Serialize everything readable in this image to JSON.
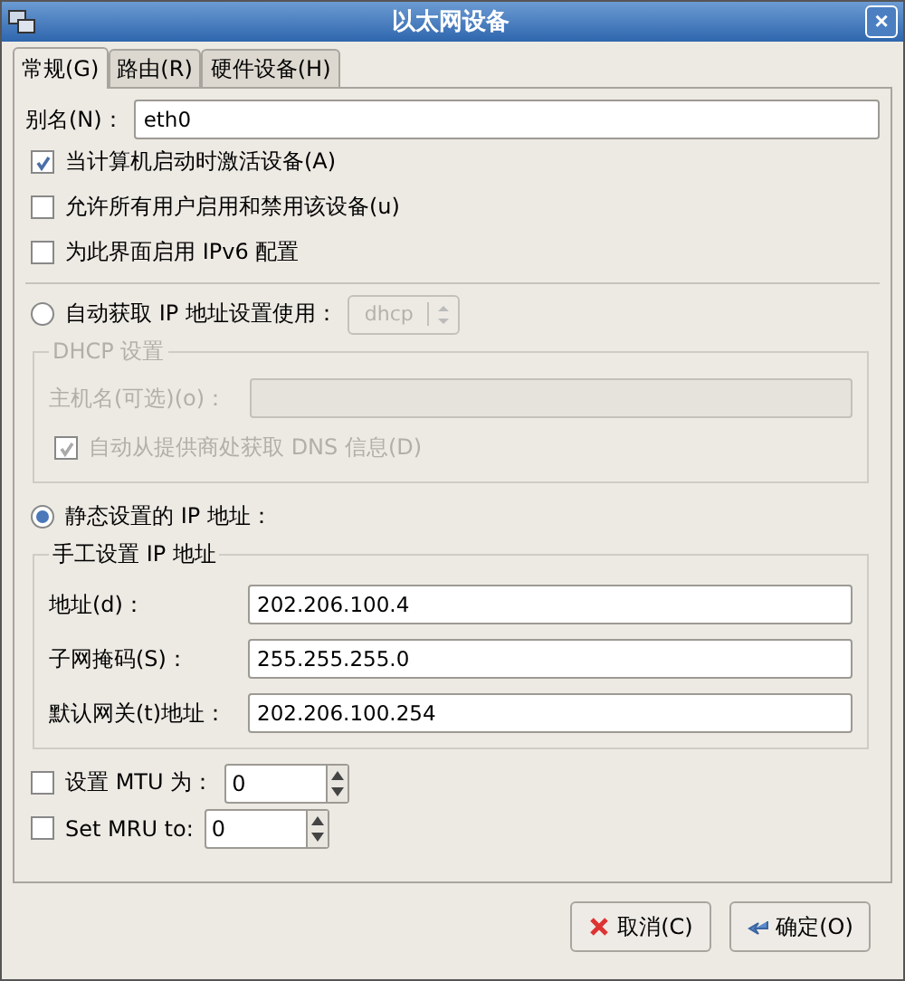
{
  "window": {
    "title": "以太网设备",
    "close": "×"
  },
  "tabs": [
    {
      "label": "常规(G)",
      "selected": true
    },
    {
      "label": "路由(R)",
      "selected": false
    },
    {
      "label": "硬件设备(H)",
      "selected": false
    }
  ],
  "alias": {
    "label": "别名(N)：",
    "value": "eth0"
  },
  "options": [
    {
      "label": "当计算机启动时激活设备(A)",
      "checked": true
    },
    {
      "label": "允许所有用户启用和禁用该设备(u)",
      "checked": false
    },
    {
      "label": "为此界面启用 IPv6 配置",
      "checked": false
    }
  ],
  "auto_ip": {
    "label": "自动获取 IP 地址设置使用：",
    "selected": false,
    "method": "dhcp",
    "disabled": true
  },
  "dhcp": {
    "title": "DHCP 设置",
    "disabled": true,
    "hostname": {
      "label": "主机名(可选)(o)："
    },
    "dns": {
      "label": "自动从提供商处获取 DNS 信息(D)",
      "checked": true
    }
  },
  "static_ip": {
    "label": "静态设置的 IP 地址：",
    "selected": true
  },
  "manual": {
    "title": "手工设置 IP 地址",
    "fields": [
      {
        "label": "地址(d)：",
        "value": "202.206.100.4"
      },
      {
        "label": "子网掩码(S)：",
        "value": "255.255.255.0"
      },
      {
        "label": "默认网关(t)地址：",
        "value": "202.206.100.254"
      }
    ]
  },
  "spins": [
    {
      "label": "设置 MTU 为：",
      "checked": false,
      "value": "0"
    },
    {
      "label": "Set MRU to:",
      "checked": false,
      "value": "0"
    }
  ],
  "buttons": [
    {
      "label": "取消(C)",
      "kind": "cancel"
    },
    {
      "label": "确定(O)",
      "kind": "ok"
    }
  ]
}
